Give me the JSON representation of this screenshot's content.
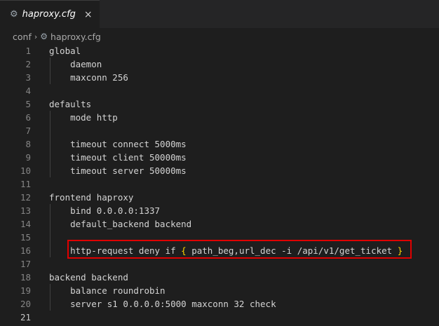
{
  "tab": {
    "icon": "gear-icon",
    "label": "haproxy.cfg",
    "close": "×"
  },
  "breadcrumb": {
    "folder": "conf",
    "separator": "›",
    "file_icon": "gear-icon",
    "file": "haproxy.cfg"
  },
  "editor": {
    "active_line": 21,
    "highlighted_line": 16,
    "lines": [
      {
        "n": "1",
        "text": "global"
      },
      {
        "n": "2",
        "text": "    daemon"
      },
      {
        "n": "3",
        "text": "    maxconn 256"
      },
      {
        "n": "4",
        "text": ""
      },
      {
        "n": "5",
        "text": "defaults"
      },
      {
        "n": "6",
        "text": "    mode http"
      },
      {
        "n": "7",
        "text": ""
      },
      {
        "n": "8",
        "text": "    timeout connect 5000ms"
      },
      {
        "n": "9",
        "text": "    timeout client 50000ms"
      },
      {
        "n": "10",
        "text": "    timeout server 50000ms"
      },
      {
        "n": "11",
        "text": ""
      },
      {
        "n": "12",
        "text": "frontend haproxy"
      },
      {
        "n": "13",
        "text": "    bind 0.0.0.0:1337"
      },
      {
        "n": "14",
        "text": "    default_backend backend"
      },
      {
        "n": "15",
        "text": ""
      },
      {
        "n": "16",
        "text": "    http-request deny if { path_beg,url_dec -i /api/v1/get_ticket }"
      },
      {
        "n": "17",
        "text": ""
      },
      {
        "n": "18",
        "text": "backend backend"
      },
      {
        "n": "19",
        "text": "    balance roundrobin"
      },
      {
        "n": "20",
        "text": "    server s1 0.0.0.0:5000 maxconn 32 check"
      },
      {
        "n": "21",
        "text": ""
      }
    ]
  },
  "colors": {
    "background": "#1e1e1e",
    "text": "#d4d4d4",
    "brace": "#ffd700",
    "highlight_border": "#e00000"
  }
}
